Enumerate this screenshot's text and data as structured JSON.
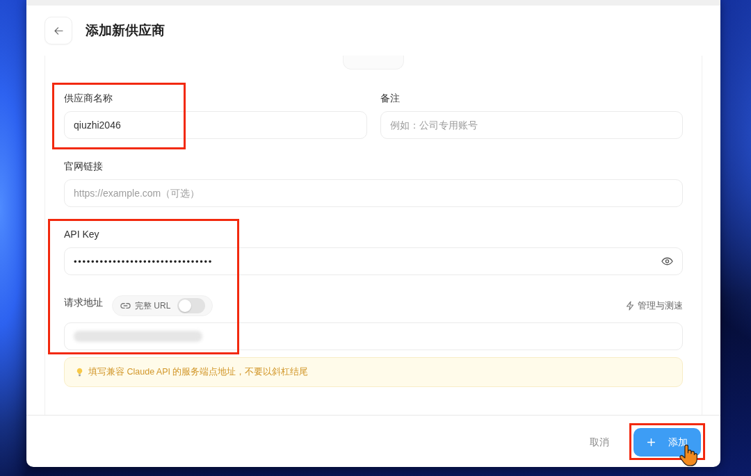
{
  "window": {
    "title": "添加新供应商"
  },
  "form": {
    "rows": [
      [
        {
          "kind": "text",
          "label": "供应商名称",
          "value": "qiuzhi2046"
        },
        {
          "kind": "text",
          "label": "备注",
          "placeholder": "例如：公司专用账号"
        }
      ],
      [
        {
          "kind": "text",
          "label": "官网链接",
          "placeholder": "https://example.com（可选）"
        }
      ],
      [
        {
          "kind": "password",
          "label": "API Key",
          "value": "••••••••••••••••••••••••••••••••"
        }
      ],
      [
        {
          "kind": "url",
          "label": "请求地址",
          "toggle": {
            "label": "完整 URL",
            "on": false
          },
          "action": {
            "label": "管理与测速"
          },
          "redacted": true
        }
      ]
    ],
    "hint": {
      "text": "填写兼容 Claude API 的服务端点地址，不要以斜杠结尾"
    }
  },
  "footer": {
    "buttons": [
      {
        "kind": "secondary",
        "label": "取消"
      },
      {
        "kind": "primary",
        "label": "添加"
      }
    ]
  }
}
